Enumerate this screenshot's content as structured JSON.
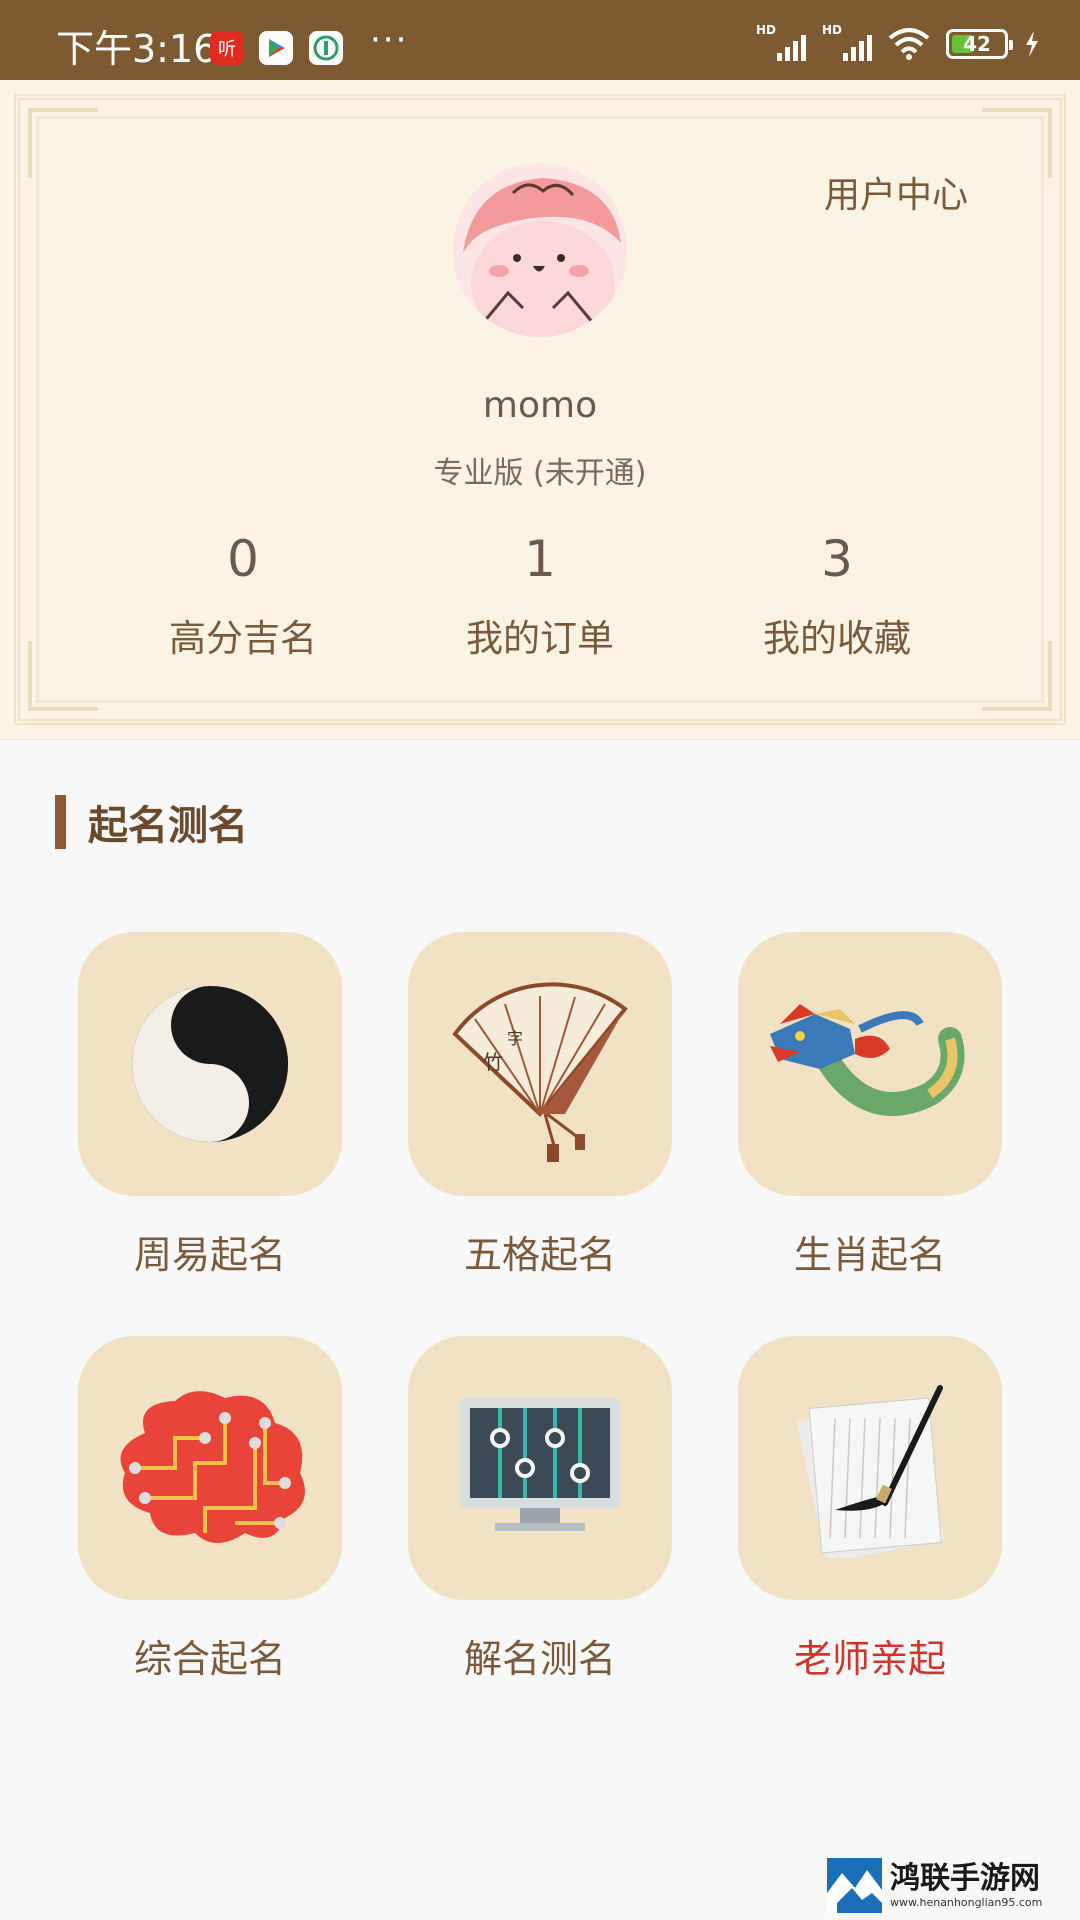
{
  "status_bar": {
    "time": "下午3:16",
    "app_listen_label": "听",
    "more": "···",
    "hd1": "HD",
    "hd2": "HD",
    "battery": "42",
    "battery_level_percent": 42
  },
  "profile": {
    "user_center": "用户中心",
    "username": "momo",
    "membership": "专业版 (未开通)",
    "stats": [
      {
        "value": "0",
        "label": "高分吉名"
      },
      {
        "value": "1",
        "label": "我的订单"
      },
      {
        "value": "3",
        "label": "我的收藏"
      }
    ]
  },
  "section": {
    "title": "起名测名",
    "items": [
      {
        "label": "周易起名",
        "icon": "yin-yang-icon"
      },
      {
        "label": "五格起名",
        "icon": "fan-icon"
      },
      {
        "label": "生肖起名",
        "icon": "dragon-icon"
      },
      {
        "label": "综合起名",
        "icon": "brain-circuit-icon"
      },
      {
        "label": "解名测名",
        "icon": "monitor-sliders-icon"
      },
      {
        "label": "老师亲起",
        "icon": "paper-brush-icon"
      }
    ]
  },
  "colors": {
    "status_bar": "#7e5a33",
    "accent": "#8b5a32",
    "tile_bg": "#f2e2c5",
    "highlight": "#d0342c"
  },
  "watermark": {
    "title": "鸿联手游网",
    "url": "www.henanhonglian95.com"
  }
}
